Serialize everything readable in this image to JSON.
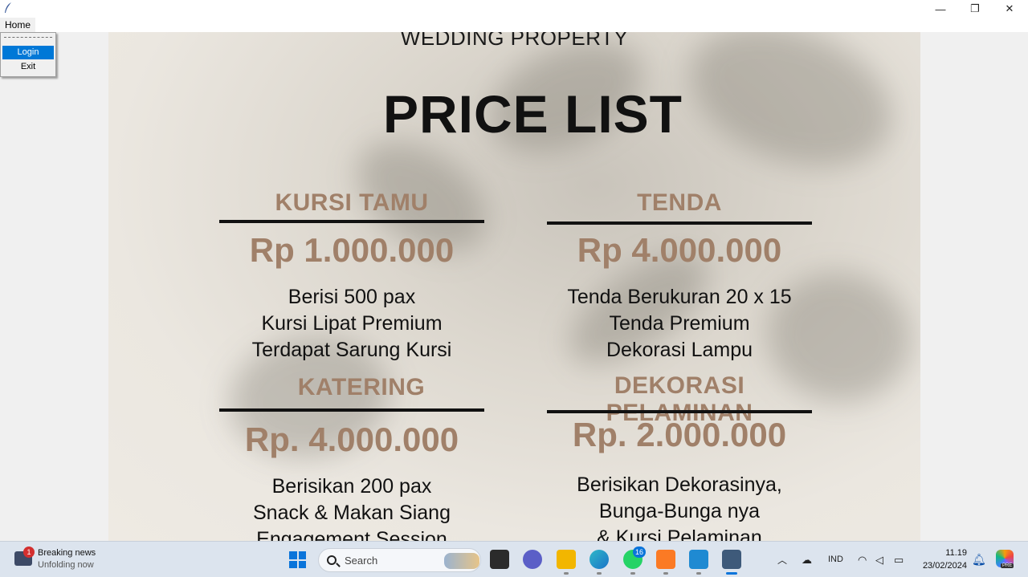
{
  "window": {
    "minimize_glyph": "—",
    "maximize_glyph": "❐",
    "close_glyph": "✕"
  },
  "menubar": {
    "home_label": "Home"
  },
  "dropdown": {
    "items": [
      "Login",
      "Exit"
    ]
  },
  "poster": {
    "header": "WEDDING PROPERTY",
    "title": "PRICE LIST",
    "categories": [
      {
        "title": "KURSI TAMU",
        "price": "Rp 1.000.000",
        "lines": [
          "Berisi 500 pax",
          "Kursi Lipat Premium",
          "Terdapat Sarung Kursi"
        ]
      },
      {
        "title": "TENDA",
        "price": "Rp 4.000.000",
        "lines": [
          "Tenda Berukuran 20 x 15",
          "Tenda Premium",
          "Dekorasi Lampu"
        ]
      },
      {
        "title": "KATERING",
        "price": "Rp. 4.000.000",
        "lines": [
          "Berisikan 200 pax",
          "Snack & Makan Siang",
          "Engagement Session"
        ]
      },
      {
        "title": "DEKORASI PELAMINAN",
        "price": "Rp. 2.000.000",
        "lines": [
          "Berisikan Dekorasinya,",
          "Bunga-Bunga nya",
          "& Kursi Pelaminan"
        ]
      }
    ]
  },
  "taskbar": {
    "news_badge": "1",
    "news_title": "Breaking news",
    "news_subtitle": "Unfolding now",
    "search_placeholder": "Search",
    "whatsapp_badge": "16",
    "language": "IND",
    "time": "11.19",
    "date": "23/02/2024",
    "copilot_badge": "PRE",
    "colors": {
      "accent": "#0a74da",
      "price": "#a08069"
    }
  }
}
